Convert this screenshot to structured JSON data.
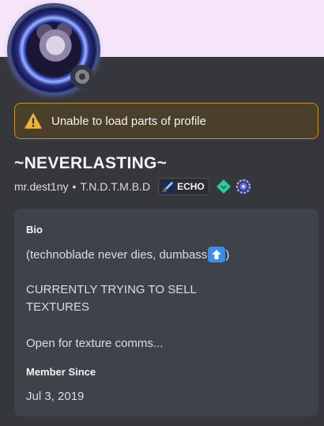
{
  "colors": {
    "banner": "#f7e6fa",
    "card_background": "#36373d",
    "panel_background": "#404249",
    "alert_border": "#c5941f",
    "alert_background": "#4a3f2a",
    "status_offline": "#80848e"
  },
  "profile": {
    "avatar_icon": "avatar-image",
    "status": "offline",
    "display_name": "~NEVERLASTING~",
    "username": "mr.dest1ny",
    "separator": "•",
    "pronouns": "T.N.D.T.M.B.D",
    "guild_tag": {
      "icon": "sword-icon",
      "label": "ECHO"
    },
    "badges": [
      "quest-badge-icon",
      "hypesquad-badge-icon"
    ]
  },
  "alert": {
    "icon": "warning-icon",
    "text": "Unable to load parts of profile"
  },
  "bio": {
    "title": "Bio",
    "line1_text": "(technoblade never dies, dumbass",
    "line1_emoji": "up-arrow-emoji",
    "line1_close": ")",
    "line2": "CURRENTLY TRYING TO SELL",
    "line3": "TEXTURES",
    "line4": "Open for texture comms..."
  },
  "member_since": {
    "title": "Member Since",
    "date": "Jul 3, 2019"
  }
}
